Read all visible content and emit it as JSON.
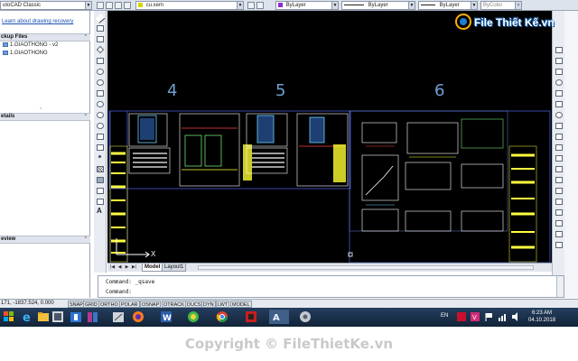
{
  "toolbar": {
    "workspace": "utoCAD Classic",
    "layer_value": "cu.xem",
    "color_value": "ByLayer",
    "linetype_value": "ByLayer",
    "lineweight_value": "ByLayer",
    "plotstyle_value": "ByColor",
    "layer_color": "#d4d400",
    "color_swatch": "#8b2bd6"
  },
  "left_panel": {
    "recover_link": "Learn about drawing recovery",
    "backup_header": "ckup Files",
    "backup_files": [
      "1.GIAOTHONG - v2",
      "1.GIAOTHONG"
    ],
    "details_header": "etails",
    "preview_header": "eview"
  },
  "logo": {
    "text": "File Thiết Kế.vn"
  },
  "canvas": {
    "background": "#000000",
    "sheet_numbers": [
      "4",
      "5",
      "6"
    ],
    "axis_x_label": "X"
  },
  "tabs": {
    "model": "Model",
    "layout1": "Layout1"
  },
  "command": {
    "line1": "Command: _qsave",
    "line2": "Command:"
  },
  "status": {
    "coords": "171, -1837.524, 0.000",
    "buttons": [
      "SNAP",
      "GRID",
      "ORTHO",
      "POLAR",
      "OSNAP",
      "OTRACK",
      "DUCS",
      "DYN",
      "LWT",
      "MODEL"
    ]
  },
  "taskbar": {
    "lang": "EN",
    "time": "6:23 AM",
    "date": "04.10.2018"
  },
  "copyright": "Copyright © FileThietKe.vn"
}
